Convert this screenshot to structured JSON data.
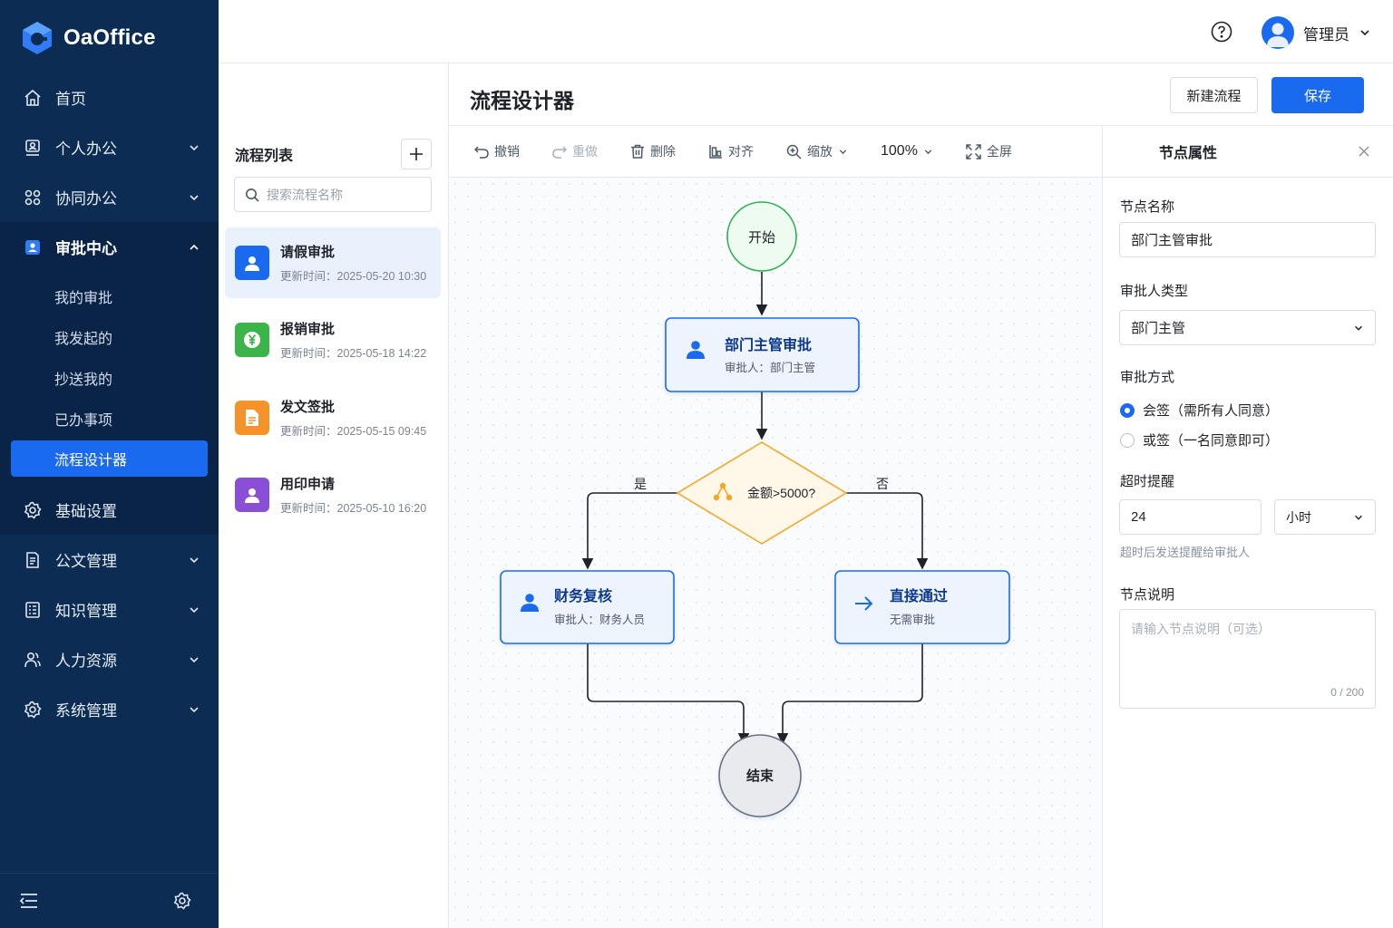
{
  "brand": {
    "name": "OaOffice"
  },
  "colors": {
    "sidebar_bg": "#0d2c54",
    "accent": "#1a6af0",
    "start_node": "#2fae4f",
    "decision_node": "#f5a623",
    "end_node": "#e8eaee"
  },
  "sidebar": {
    "items": [
      {
        "label": "首页",
        "icon": "home-icon"
      },
      {
        "label": "个人办公",
        "icon": "user-desk-icon"
      },
      {
        "label": "协同办公",
        "icon": "grid-icon"
      },
      {
        "label": "审批中心",
        "icon": "approval-icon"
      },
      {
        "label": "基础设置",
        "icon": "gear-icon"
      },
      {
        "label": "公文管理",
        "icon": "document-icon"
      },
      {
        "label": "知识管理",
        "icon": "knowledge-icon"
      },
      {
        "label": "人力资源",
        "icon": "people-icon"
      },
      {
        "label": "系统管理",
        "icon": "system-gear-icon"
      }
    ],
    "approval_sub": [
      "我的审批",
      "我发起的",
      "抄送我的",
      "已办事项",
      "流程设计器"
    ]
  },
  "topbar": {
    "user_name": "管理员"
  },
  "page": {
    "title": "流程设计器",
    "new_flow": "新建流程",
    "save": "保存"
  },
  "flow_list": {
    "title": "流程列表",
    "search_placeholder": "搜索流程名称",
    "time_prefix": "更新时间：",
    "items": [
      {
        "name": "请假审批",
        "time": "2025-05-20 10:30",
        "color": "#1a6af0",
        "icon": "user-icon"
      },
      {
        "name": "报销审批",
        "time": "2025-05-18 14:22",
        "color": "#3bb54a",
        "icon": "yen-icon"
      },
      {
        "name": "发文签批",
        "time": "2025-05-15 09:45",
        "color": "#f6922a",
        "icon": "file-icon"
      },
      {
        "name": "用印申请",
        "time": "2025-05-10 16:20",
        "color": "#8a4fd6",
        "icon": "user-icon"
      }
    ]
  },
  "toolbar": {
    "undo": "撤销",
    "redo": "重做",
    "delete": "删除",
    "align": "对齐",
    "zoom": "缩放",
    "zoom_value": "100%",
    "fullscreen": "全屏"
  },
  "flow": {
    "start": "开始",
    "approve": {
      "title": "部门主管审批",
      "sub": "审批人：部门主管"
    },
    "decision": "金额>5000?",
    "yes": "是",
    "no": "否",
    "finance": {
      "title": "财务复核",
      "sub": "审批人：财务人员"
    },
    "pass": {
      "title": "直接通过",
      "sub": "无需审批"
    },
    "end": "结束"
  },
  "props": {
    "title": "节点属性",
    "name_label": "节点名称",
    "name_value": "部门主管审批",
    "approver_type_label": "审批人类型",
    "approver_type_value": "部门主管",
    "method_label": "审批方式",
    "method_options": [
      "会签（需所有人同意）",
      "或签（一名同意即可）"
    ],
    "method_selected": 0,
    "timeout_label": "超时提醒",
    "timeout_value": "24",
    "timeout_unit": "小时",
    "timeout_hint": "超时后发送提醒给审批人",
    "desc_label": "节点说明",
    "desc_placeholder": "请输入节点说明（可选）",
    "desc_count": "0 / 200"
  }
}
